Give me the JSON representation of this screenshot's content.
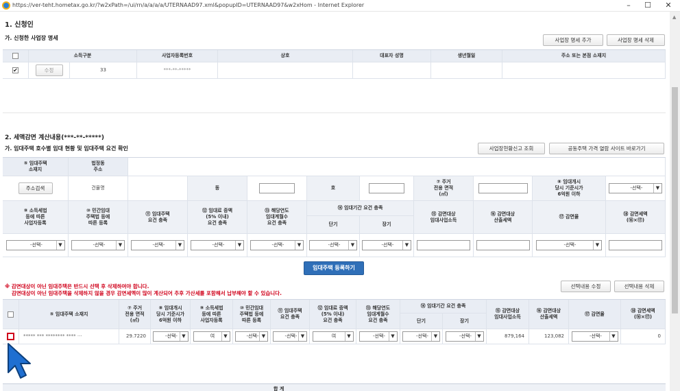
{
  "window": {
    "url": "https://ver-teht.hometax.go.kr/?w2xPath=/ui/rn/a/a/a/a/UTERNAAD97.xml&popupID=UTERNAAD97&w2xHom - Internet Explorer",
    "minimize": "–",
    "maximize": "☐",
    "close": "✕"
  },
  "section1": {
    "title": "1. 신청인",
    "subtitle": "가. 신청한 사업장 명세",
    "add_button": "사업장 명세 추가",
    "delete_button": "사업장 명세 삭제",
    "columns": [
      "소득구분",
      "사업자등록번호",
      "상호",
      "대표자 성명",
      "생년월일",
      "주소 또는 본점 소재지"
    ],
    "row": {
      "edit_button": "수정",
      "income_type": "33",
      "business_no": "***-**-*****",
      "checked": "✔"
    }
  },
  "section2": {
    "title": "2. 세액감면 계산내용(***-**-*****)",
    "subtitle": "가. 임대주택 호수별 임대 현황 및 임대주택 요건 확인",
    "report_button": "사업장현황신고 조회",
    "price_site_button": "공동주택 가격 열람 사이트 바로가기",
    "form": {
      "h_location": "⑤ 임대주택\n소재지",
      "h_legal_addr": "법정동\n주소",
      "address_search_button": "주소검색",
      "building_name": "건물명",
      "dong": "동",
      "ho": "호",
      "h_area": "⑦ 주거\n전용 면적\n(㎡)",
      "h_price": "⑧ 임대개시\n당시 기준시가\n6억원 이하",
      "select_placeholder": "-선택-",
      "h_row2": [
        "⑨ 소득세법\n등에 따른\n사업자등록",
        "⑩ 민간임대\n주택법 등에\n따른 등록",
        "⑪ 임대주택\n요건 충족",
        "⑫ 임대료 증액\n(5% 이내)\n요건 충족",
        "⑬ 해당연도\n임대계월수\n요건 충족"
      ],
      "h_period": "⑭ 임대기간 요건 충족",
      "h_short": "단기",
      "h_long": "장기",
      "h_income": "⑮ 감면대상\n임대사업소득",
      "h_tax": "⑯ 감면대상\n산출세액",
      "h_rate": "⑰ 감면율",
      "h_reduction": "⑱ 감면세액\n(⑯×⑰)"
    },
    "register_button": "임대주택 등록하기",
    "warning_line1": "※ 감면대상이 아닌 임대주택은 반드시 선택 후 삭제하여야 합니다.",
    "warning_line2": "감면대상이 아닌 임대주택을 삭제하지 않을 경우 감면세액이 많이 계산되어 추후 가산세를 포함해서 납부해야 할 수 있습니다.",
    "edit_selection_button": "선택내용 수정",
    "delete_selection_button": "선택내용 삭제",
    "table": {
      "h_location": "⑤ 임대주택 소재지",
      "h_area": "⑦ 주거\n전용 면적\n(㎡)",
      "h_price": "⑧ 임대개시\n당시 기준시가\n6억원 이하",
      "h_biz": "⑨ 소득세법\n등에 따른\n사업자등록",
      "h_private": "⑩ 민간임대\n주택법 등에\n따른 등록",
      "h_req": "⑪ 임대주택\n요건 충족",
      "h_rent": "⑫ 임대료 증액\n(5% 이내)\n요건 충족",
      "h_months": "⑬ 해당연도\n임대계월수\n요건 충족",
      "h_period": "⑭ 임대기간 요건 충족",
      "h_short": "단기",
      "h_long": "장기",
      "h_income": "⑮ 감면대상\n임대사업소득",
      "h_tax": "⑯ 감면대상\n산출세액",
      "h_rate": "⑰ 감면율",
      "h_reduction": "⑱ 감면세액\n(⑯×⑰)",
      "row": {
        "address": "***** *** ******** **** ···",
        "area": "29.7220",
        "price": "-선택-",
        "biz": "여",
        "private": "-선택-",
        "req": "-선택-",
        "rent": "여",
        "months": "-선택-",
        "short": "-선택-",
        "long": "-선택-",
        "income": "879,164",
        "tax": "123,082",
        "rate": "-선택-",
        "reduction": "0"
      }
    },
    "total_label": "합 계"
  }
}
